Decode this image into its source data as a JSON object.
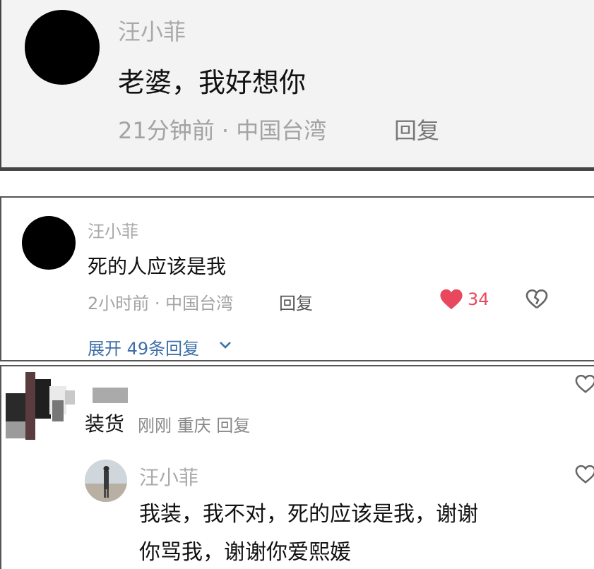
{
  "comment1": {
    "author": "汪小菲",
    "text": "老婆，我好想你",
    "meta": "21分钟前 · 中国台湾",
    "reply_label": "回复"
  },
  "comment2": {
    "author": "汪小菲",
    "text": "死的人应该是我",
    "meta": "2小时前 · 中国台湾",
    "reply_label": "回复",
    "likes": "34",
    "expand_label": "展开 49条回复"
  },
  "comment3": {
    "author_nick": "装货",
    "meta": "刚刚 重庆 回复",
    "reply": {
      "author": "汪小菲",
      "line1": "我装，我不对，死的应该是我，谢谢",
      "line2": "你骂我，谢谢你爱熙媛"
    }
  },
  "icons": {
    "like": "heart-icon",
    "dislike": "broken-heart-icon",
    "expand": "chevron-down-icon"
  },
  "colors": {
    "like": "#e8475d",
    "link": "#3d6fa8"
  }
}
